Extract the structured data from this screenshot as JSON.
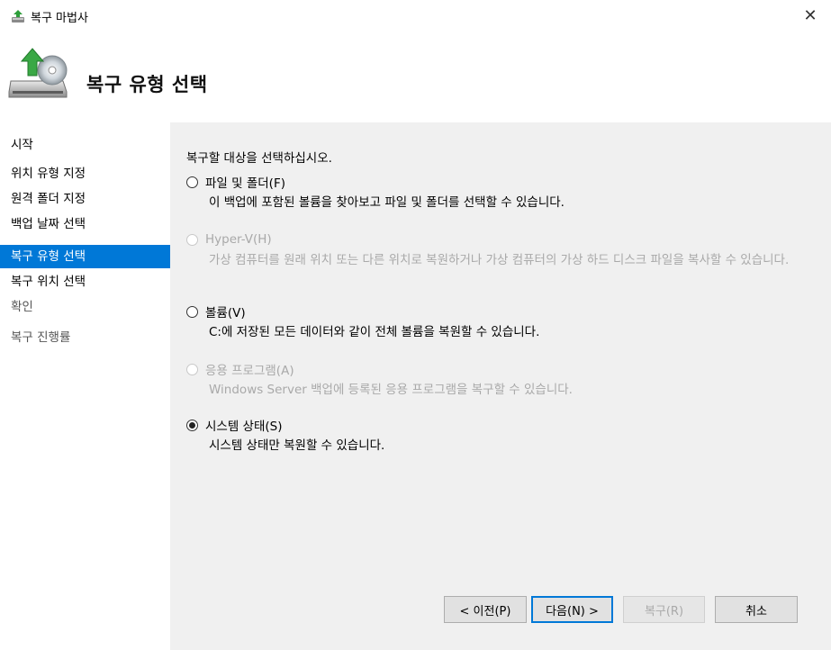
{
  "window": {
    "title": "복구 마법사",
    "close_glyph": "✕"
  },
  "header": {
    "title": "복구 유형 선택",
    "icon": "backup-restore-icon"
  },
  "sidebar": {
    "items": [
      {
        "label": "시작",
        "state": "normal"
      },
      {
        "label": "위치 유형 지정",
        "state": "normal"
      },
      {
        "label": "원격 폴더 지정",
        "state": "normal"
      },
      {
        "label": "백업 날짜 선택",
        "state": "normal"
      },
      {
        "label": "복구 유형 선택",
        "state": "active"
      },
      {
        "label": "복구 위치 선택",
        "state": "normal"
      },
      {
        "label": "확인",
        "state": "dim"
      },
      {
        "label": "복구 진행률",
        "state": "dim"
      }
    ]
  },
  "main": {
    "prompt": "복구할 대상을 선택하십시오.",
    "options": [
      {
        "label": "파일 및 폴더(F)",
        "desc": "이 백업에 포함된 볼륨을 찾아보고 파일 및 폴더를 선택할 수 있습니다.",
        "enabled": true,
        "checked": false
      },
      {
        "label": "Hyper-V(H)",
        "desc": "가상 컴퓨터를 원래 위치 또는 다른 위치로 복원하거나 가상 컴퓨터의 가상 하드 디스크 파일을 복사할 수 있습니다.",
        "enabled": false,
        "checked": false
      },
      {
        "label": "볼륨(V)",
        "desc": "C:에 저장된 모든 데이터와 같이 전체 볼륨을 복원할 수 있습니다.",
        "enabled": true,
        "checked": false
      },
      {
        "label": "응용 프로그램(A)",
        "desc": "Windows Server 백업에 등록된 응용 프로그램을 복구할 수 있습니다.",
        "enabled": false,
        "checked": false
      },
      {
        "label": "시스템 상태(S)",
        "desc": "시스템 상태만 복원할 수 있습니다.",
        "enabled": true,
        "checked": true
      }
    ]
  },
  "buttons": {
    "back": "< 이전(P)",
    "next": "다음(N) >",
    "recover": "복구(R)",
    "cancel": "취소"
  },
  "colors": {
    "accent": "#0078d7",
    "disabled_text": "#a9a9a9",
    "panel_bg": "#f0f0f0"
  }
}
